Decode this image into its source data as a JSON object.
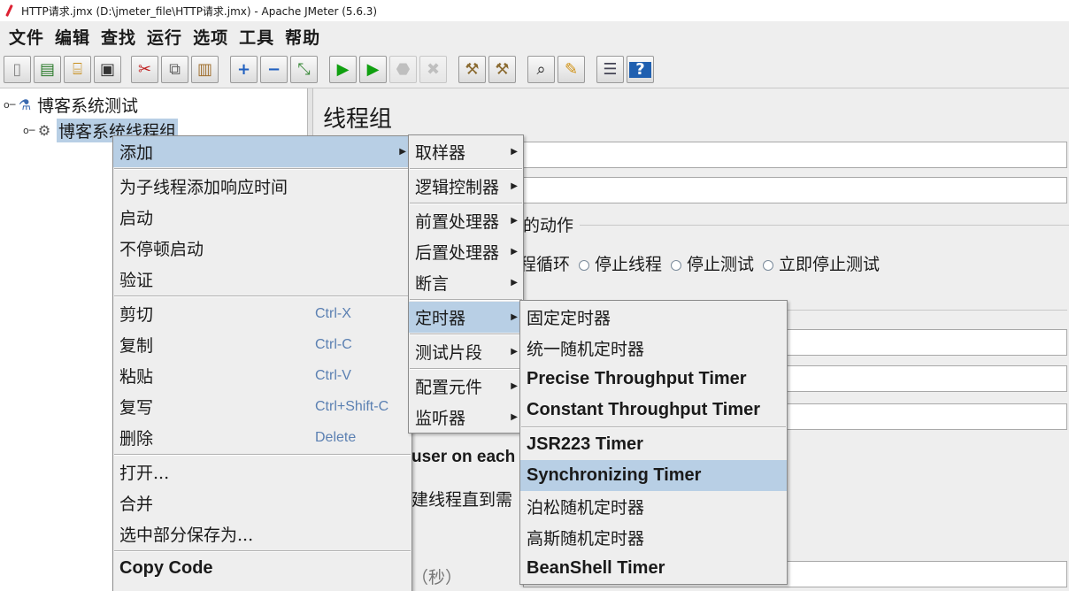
{
  "window": {
    "title": "HTTP请求.jmx (D:\\jmeter_file\\HTTP请求.jmx) - Apache JMeter (5.6.3)"
  },
  "menubar": [
    "文件",
    "编辑",
    "查找",
    "运行",
    "选项",
    "工具",
    "帮助"
  ],
  "toolbar": [
    {
      "icon": "new-icon",
      "glyph": "▯"
    },
    {
      "icon": "templates-icon",
      "glyph": "▤"
    },
    {
      "icon": "open-icon",
      "glyph": "⌸"
    },
    {
      "icon": "save-icon",
      "glyph": "▣"
    },
    {
      "icon": "cut-icon",
      "glyph": "✂"
    },
    {
      "icon": "copy-icon",
      "glyph": "⧉"
    },
    {
      "icon": "paste-icon",
      "glyph": "▥"
    },
    {
      "icon": "expand-icon",
      "glyph": "+"
    },
    {
      "icon": "collapse-icon",
      "glyph": "−"
    },
    {
      "icon": "toggle-icon",
      "glyph": "⤡"
    },
    {
      "icon": "start-icon",
      "glyph": "▶"
    },
    {
      "icon": "start-no-pauses-icon",
      "glyph": "▶"
    },
    {
      "icon": "stop-icon",
      "glyph": "⬣"
    },
    {
      "icon": "shutdown-icon",
      "glyph": "✖"
    },
    {
      "icon": "clear-icon",
      "glyph": "⚒"
    },
    {
      "icon": "clear-all-icon",
      "glyph": "⚒"
    },
    {
      "icon": "search-icon",
      "glyph": "⌕"
    },
    {
      "icon": "reset-search-icon",
      "glyph": "✎"
    },
    {
      "icon": "function-helper-icon",
      "glyph": "☰"
    },
    {
      "icon": "help-icon",
      "glyph": "?"
    }
  ],
  "tree": {
    "test_plan": "博客系统测试",
    "thread_group": "博客系统线程组"
  },
  "panel": {
    "title": "线程组",
    "action_label_tail": "的动作",
    "radio_options": [
      "程循环",
      "停止线程",
      "停止测试",
      "立即停止测试"
    ],
    "same_user_tail": "user on each",
    "delay_tail": "建线程直到需",
    "seconds_tail": "（秒）"
  },
  "menu_main": {
    "items": [
      {
        "label": "添加",
        "submenu": true,
        "highlight": true
      },
      {
        "label": "为子线程添加响应时间"
      },
      {
        "label": "启动"
      },
      {
        "label": "不停顿启动"
      },
      {
        "label": "验证"
      },
      {
        "label": "剪切",
        "shortcut": "Ctrl-X"
      },
      {
        "label": "复制",
        "shortcut": "Ctrl-C"
      },
      {
        "label": "粘贴",
        "shortcut": "Ctrl-V"
      },
      {
        "label": "复写",
        "shortcut": "Ctrl+Shift-C"
      },
      {
        "label": "删除",
        "shortcut": "Delete"
      },
      {
        "label": "打开..."
      },
      {
        "label": "合并"
      },
      {
        "label": "选中部分保存为..."
      },
      {
        "label": "Copy Code"
      }
    ]
  },
  "menu_add": {
    "items": [
      "取样器",
      "逻辑控制器",
      "前置处理器",
      "后置处理器",
      "断言",
      "定时器",
      "测试片段",
      "配置元件",
      "监听器"
    ],
    "highlighted": "定时器"
  },
  "menu_timer": {
    "items": [
      "固定定时器",
      "统一随机定时器",
      "Precise Throughput Timer",
      "Constant Throughput Timer",
      "JSR223 Timer",
      "Synchronizing Timer",
      "泊松随机定时器",
      "高斯随机定时器",
      "BeanShell Timer"
    ],
    "highlighted": "Synchronizing Timer"
  },
  "colors": {
    "highlight": "#b8cfe5",
    "shortcut": "#5b80b2",
    "menu_bg": "#eeeeee"
  }
}
